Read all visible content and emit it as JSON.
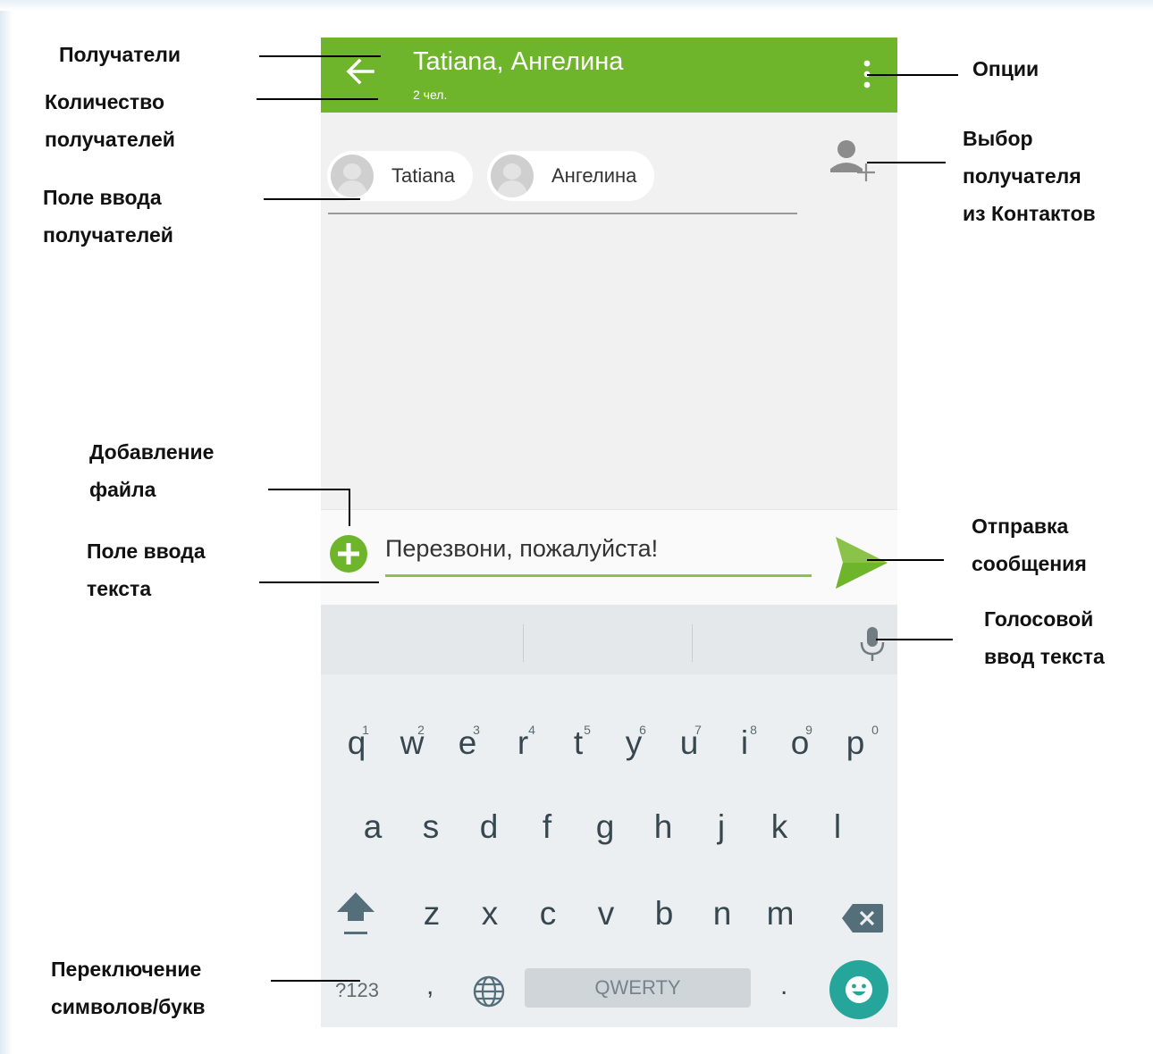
{
  "app_bar": {
    "title": "Tatiana, Ангелина",
    "subtitle": "2 чел.",
    "back_icon": "arrow-left-icon",
    "menu_icon": "more-vert-icon"
  },
  "recipients": {
    "chips": [
      {
        "name": "Tatiana"
      },
      {
        "name": "Ангелина"
      }
    ],
    "add_contact_icon": "person-add-icon"
  },
  "compose": {
    "message_text": "Перезвони, пожалуйста!",
    "attach_icon": "add-circle-icon",
    "send_icon": "send-icon"
  },
  "keyboard": {
    "row1": [
      {
        "key": "q",
        "hint": "1"
      },
      {
        "key": "w",
        "hint": "2"
      },
      {
        "key": "e",
        "hint": "3"
      },
      {
        "key": "r",
        "hint": "4"
      },
      {
        "key": "t",
        "hint": "5"
      },
      {
        "key": "y",
        "hint": "6"
      },
      {
        "key": "u",
        "hint": "7"
      },
      {
        "key": "i",
        "hint": "8"
      },
      {
        "key": "o",
        "hint": "9"
      },
      {
        "key": "p",
        "hint": "0"
      }
    ],
    "row2": [
      "a",
      "s",
      "d",
      "f",
      "g",
      "h",
      "j",
      "k",
      "l"
    ],
    "row3": [
      "z",
      "x",
      "c",
      "v",
      "b",
      "n",
      "m"
    ],
    "symbols_key": "?123",
    "comma_key": ",",
    "period_key": ".",
    "space_label": "QWERTY",
    "shift_icon": "shift-icon",
    "backspace_icon": "backspace-icon",
    "globe_icon": "globe-icon",
    "emoji_icon": "emoji-icon",
    "mic_icon": "mic-icon"
  },
  "colors": {
    "app_bar": "#6fb52c",
    "accent": "#8bc34a",
    "emoji_button": "#26a69a"
  },
  "callouts": {
    "recipients": "Получатели",
    "recipient_count": "Количество\nполучателей",
    "recipient_field": "Поле ввода\nполучателей",
    "options": "Опции",
    "pick_from_contacts": "Выбор\nполучателя\nиз Контактов",
    "add_file": "Добавление\nфайла",
    "text_field": "Поле ввода\nтекста",
    "send_message": "Отправка\nсообщения",
    "voice_input": "Голосовой\nввод текста",
    "switch_symbols": "Переключение\nсимволов/букв"
  }
}
